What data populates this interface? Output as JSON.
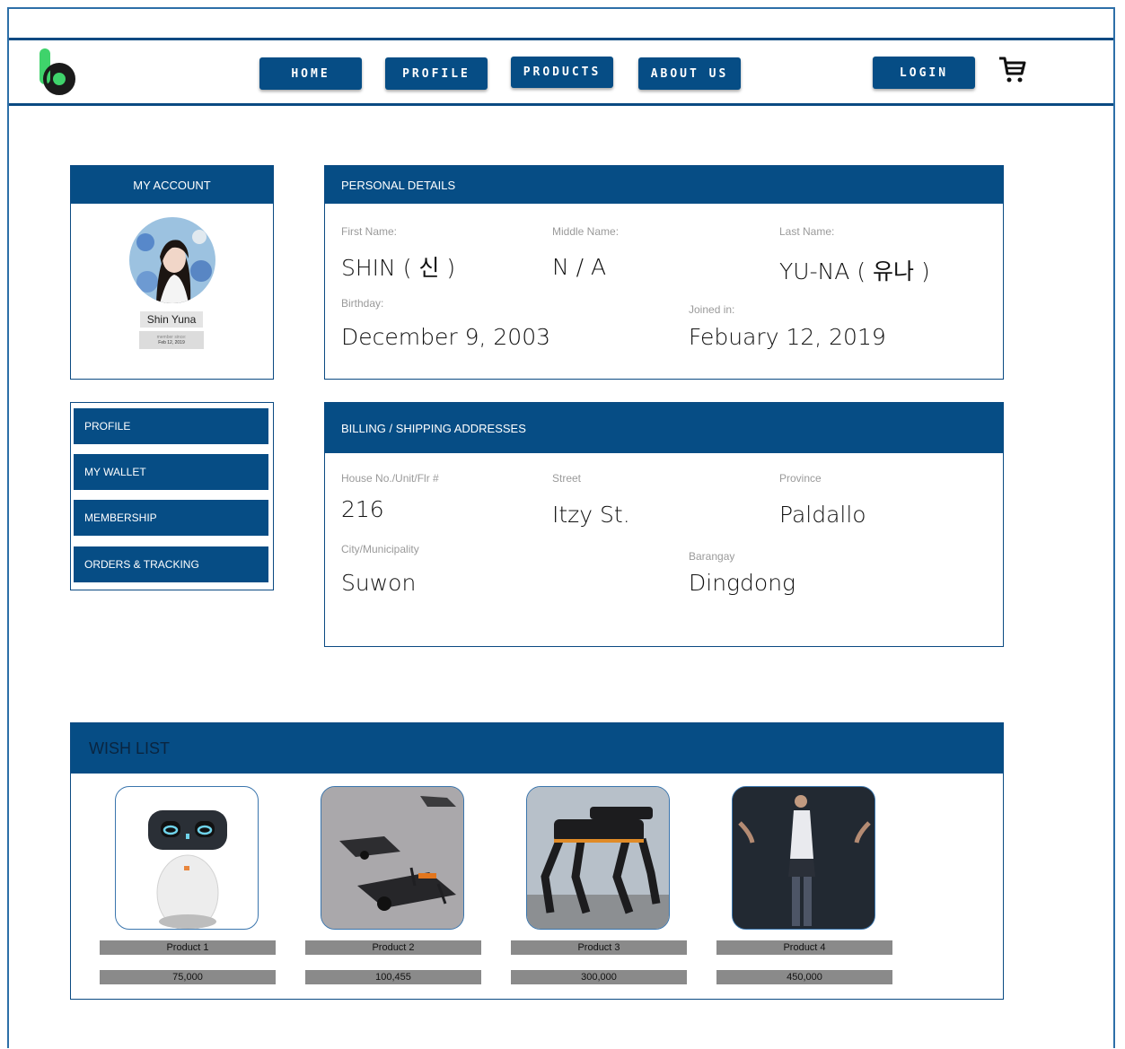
{
  "nav": {
    "home": "HOME",
    "profile": "PROFILE",
    "products": "PRODUCTS",
    "about": "ABOUT US",
    "login": "LOGIN"
  },
  "icons": {
    "logo": "brand-logo-icon",
    "cart": "shopping-cart-icon"
  },
  "colors": {
    "primary": "#064d85",
    "logo_green": "#3fd36b",
    "logo_dark": "#1b1b1b"
  },
  "account": {
    "title": "MY ACCOUNT",
    "name": "Shin Yuna",
    "member_since_label": "member since:",
    "member_since_date": "Feb 12, 2019"
  },
  "sidemenu": [
    "PROFILE",
    "MY WALLET",
    "MEMBERSHIP",
    "ORDERS & TRACKING"
  ],
  "personal": {
    "title": "PERSONAL DETAILS",
    "first_name_label": "First Name:",
    "first_name": "SHIN ( 신 )",
    "middle_name_label": "Middle Name:",
    "middle_name": "N / A",
    "last_name_label": "Last Name:",
    "last_name": "YU-NA ( 유나 )",
    "birthday_label": "Birthday:",
    "birthday": "December 9, 2003",
    "joined_label": "Joined in:",
    "joined": "Febuary 12, 2019"
  },
  "address": {
    "title": "BILLING / SHIPPING ADDRESSES",
    "house_label": "House No./Unit/Flr #",
    "house": "216",
    "street_label": "Street",
    "street": "Itzy St.",
    "province_label": "Province",
    "province": "Paldallo",
    "city_label": "City/Municipality",
    "city": "Suwon",
    "barangay_label": "Barangay",
    "barangay": "Dingdong"
  },
  "wishlist": {
    "title": "WISH LIST",
    "products": [
      {
        "name": "Product 1",
        "price": "75,000"
      },
      {
        "name": "Product 2",
        "price": "100,455"
      },
      {
        "name": "Product 3",
        "price": "300,000"
      },
      {
        "name": "Product 4",
        "price": "450,000"
      }
    ]
  }
}
